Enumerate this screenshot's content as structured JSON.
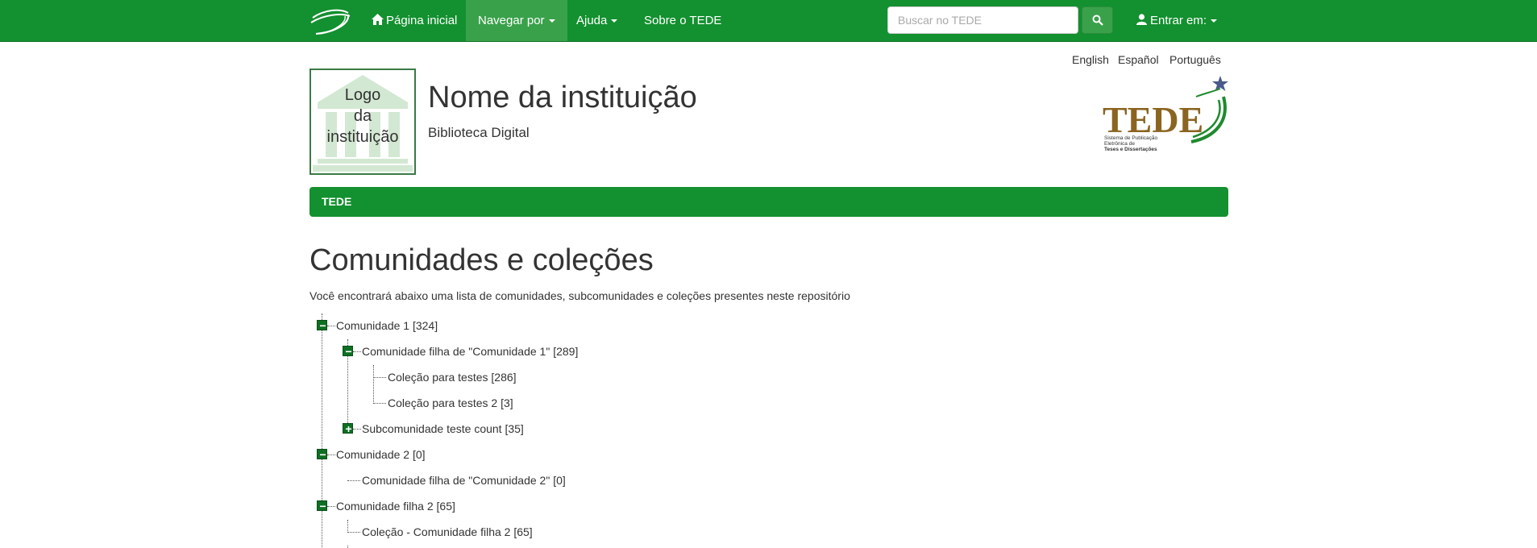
{
  "navbar": {
    "home": "Página inicial",
    "browse": "Navegar por",
    "help": "Ajuda",
    "about": "Sobre o TEDE",
    "search_placeholder": "Buscar no TEDE",
    "login": "Entrar em:"
  },
  "languages": [
    "English",
    "Español",
    "Português"
  ],
  "institution": {
    "logo_text": [
      "Logo",
      "da",
      "instituição"
    ],
    "name": "Nome da instituição",
    "subtitle": "Biblioteca Digital"
  },
  "tede_logo": {
    "word": "TEDE",
    "tagline": [
      "Sistema de Publicação",
      "Eletrônica de",
      "Teses e Dissertações"
    ]
  },
  "breadcrumb": "TEDE",
  "page": {
    "title": "Comunidades e coleções",
    "intro": "Você encontrará abaixo uma lista de comunidades, subcomunidades e coleções presentes neste repositório"
  },
  "tree": [
    {
      "label": "Comunidade 1 [324]",
      "level": 0,
      "toggle": "collapse"
    },
    {
      "label": "Comunidade filha de \"Comunidade 1\" [289]",
      "level": 1,
      "toggle": "collapse"
    },
    {
      "label": "Coleção para testes [286]",
      "level": 2,
      "toggle": "none"
    },
    {
      "label": "Coleção para testes 2 [3]",
      "level": 2,
      "toggle": "none"
    },
    {
      "label": "Subcomunidade teste count [35]",
      "level": 1,
      "toggle": "expand"
    },
    {
      "label": "Comunidade 2 [0]",
      "level": 0,
      "toggle": "collapse"
    },
    {
      "label": "Comunidade filha de \"Comunidade 2\" [0]",
      "level": 1,
      "toggle": "none"
    },
    {
      "label": "Comunidade filha 2 [65]",
      "level": 0,
      "toggle": "collapse"
    },
    {
      "label": "Coleção - Comunidade filha 2 [65]",
      "level": 1,
      "toggle": "none"
    }
  ],
  "colors": {
    "navbar": "#13902f",
    "navbar_active": "#3aa14b",
    "toggle": "#0d6f23"
  }
}
